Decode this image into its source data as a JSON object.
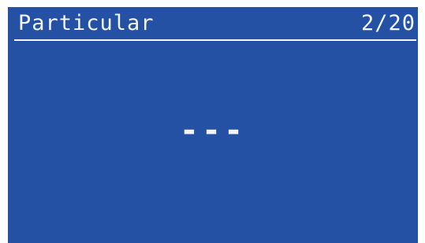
{
  "header": {
    "title": "Particular",
    "page_indicator": "2/20"
  },
  "main": {
    "value": "---"
  },
  "colors": {
    "screen_background": "#2451a4",
    "foreground": "#f2f5fb",
    "page_background": "#ffffff"
  }
}
